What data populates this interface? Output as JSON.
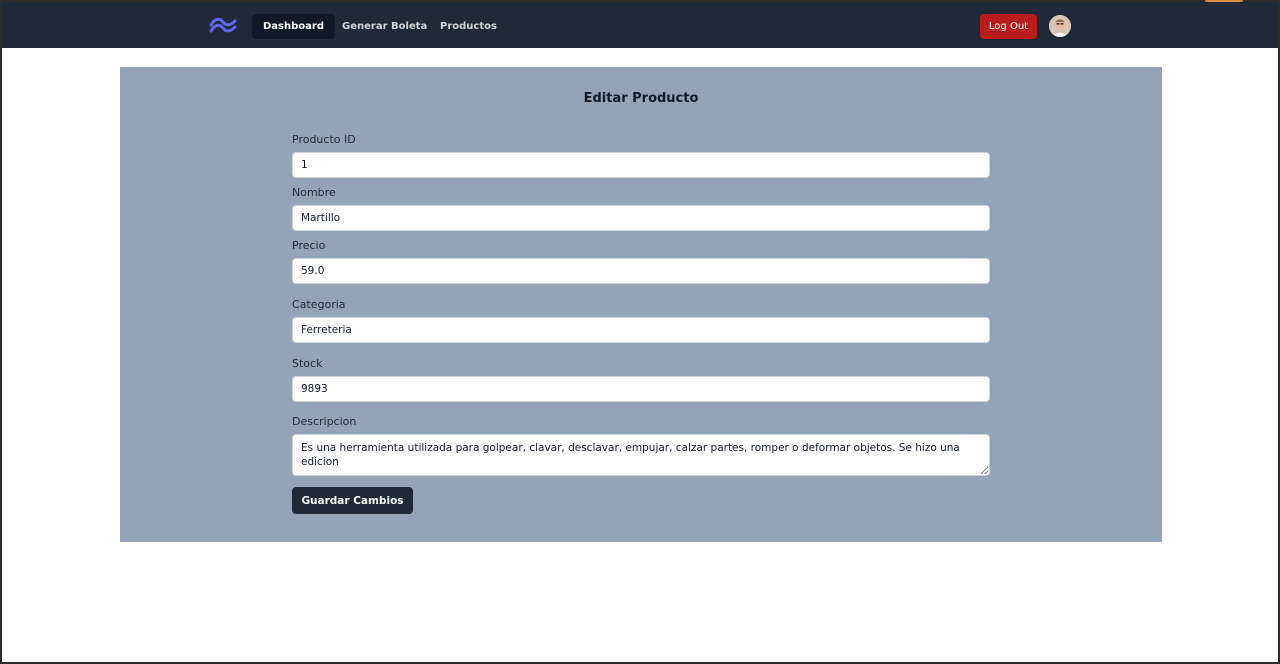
{
  "nav": {
    "logo_icon": "tailwind-wave-logo",
    "links": [
      {
        "label": "Dashboard",
        "active": true
      },
      {
        "label": "Generar Boleta",
        "active": false
      },
      {
        "label": "Productos",
        "active": false
      }
    ],
    "logout_label": "Log Out",
    "avatar_icon": "user-avatar"
  },
  "form": {
    "title": "Editar Producto",
    "fields": {
      "producto_id": {
        "label": "Producto ID",
        "value": "1"
      },
      "nombre": {
        "label": "Nombre",
        "value": "Martillo"
      },
      "precio": {
        "label": "Precio",
        "value": "59.0"
      },
      "categoria": {
        "label": "Categoria",
        "value": "Ferreteria"
      },
      "stock": {
        "label": "Stock",
        "value": "9893"
      },
      "descripcion": {
        "label": "Descripcion",
        "value": "Es una herramienta utilizada para golpear, clavar, desclavar, empujar, calzar partes, romper o deformar objetos. Se hizo una edicion"
      }
    },
    "submit_label": "Guardar Cambios"
  },
  "colors": {
    "nav_bg": "#1f2937",
    "nav_active_bg": "#111827",
    "panel_bg": "#94a3b8",
    "logout_bg": "#b91c1c",
    "submit_bg": "#1f2937",
    "logo_color": "#6366f1"
  }
}
